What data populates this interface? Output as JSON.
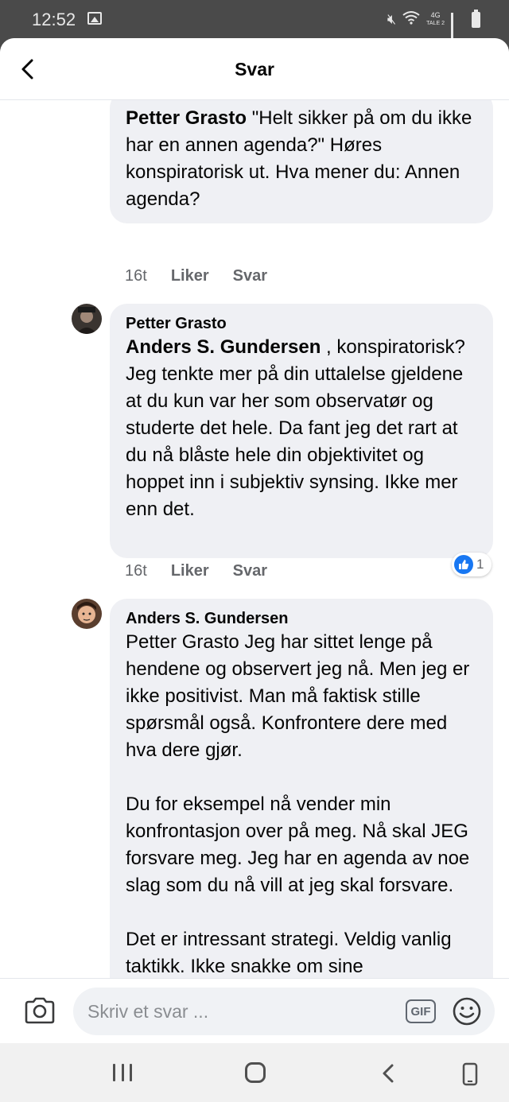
{
  "status_bar": {
    "time": "12:52",
    "network": "4G",
    "network_sub": "TALE 2"
  },
  "header": {
    "title": "Svar"
  },
  "comments": [
    {
      "author": "Petter Grasto",
      "text": "\"Helt sikker på om du ikke har en annen agenda?\" Høres konspiratorisk ut. Hva mener du: Annen agenda?",
      "time": "16t",
      "like_label": "Liker",
      "reply_label": "Svar"
    },
    {
      "author": "Petter Grasto",
      "mention": "Anders S. Gundersen",
      "text": " , konspiratorisk? Jeg tenkte mer på din uttalelse gjeldene at du kun var her som observatør og studerte det hele. Da fant jeg det rart at du nå blåste hele din objektivitet og hoppet inn i subjektiv synsing. Ikke mer enn det.",
      "time": "16t",
      "like_label": "Liker",
      "reply_label": "Svar",
      "reaction_count": "1"
    },
    {
      "author": "Anders S. Gundersen",
      "paragraphs": [
        "Petter Grasto Jeg har sittet lenge på hendene og observert jeg nå. Men jeg er ikke positivist. Man må faktisk stille spørsmål også. Konfrontere dere med hva dere gjør.",
        "Du for eksempel nå vender min konfrontasjon over på meg. Nå skal JEG forsvare meg. Jeg har en agenda av noe slag som du nå vill at jeg skal forsvare.",
        "Det er intressant strategi. Veldig vanlig taktikk. Ikke snakke om sine"
      ]
    }
  ],
  "composer": {
    "placeholder": "Skriv et svar ...",
    "gif_label": "GIF"
  },
  "colors": {
    "bubble": "#eff0f4",
    "meta": "#65676b",
    "like_blue": "#1877f2"
  }
}
